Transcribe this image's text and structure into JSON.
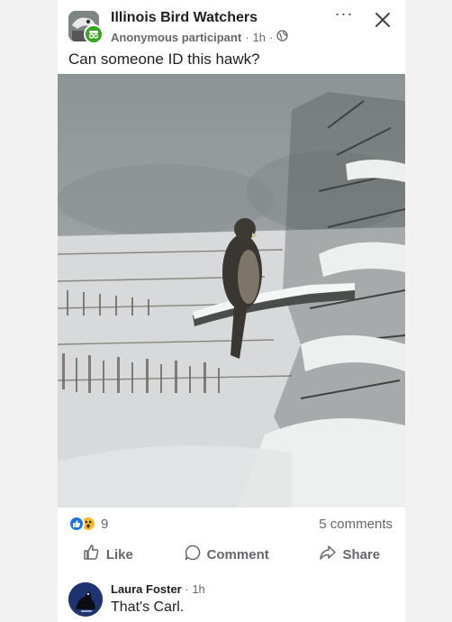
{
  "header": {
    "group_name": "Illinois Bird Watchers",
    "author": "Anonymous participant",
    "separator": "·",
    "time": "1h",
    "privacy_icon": "globe-icon",
    "more_icon": "more-dots-icon",
    "close_icon": "close-icon"
  },
  "post": {
    "text": "Can someone ID this hawk?",
    "photo_subject": "hawk perched on a snowy branch"
  },
  "stats": {
    "reaction_icons": [
      "like-icon",
      "wow-icon"
    ],
    "reaction_count": "9",
    "comments": "5 comments"
  },
  "actions": {
    "like": "Like",
    "comment": "Comment",
    "share": "Share"
  },
  "comment": {
    "name": "Laura Foster",
    "time": "· 1h",
    "text": "That's Carl."
  },
  "colors": {
    "accent_blue": "#1b74e4",
    "anon_green": "#36a420",
    "muted_text": "#65676b"
  }
}
